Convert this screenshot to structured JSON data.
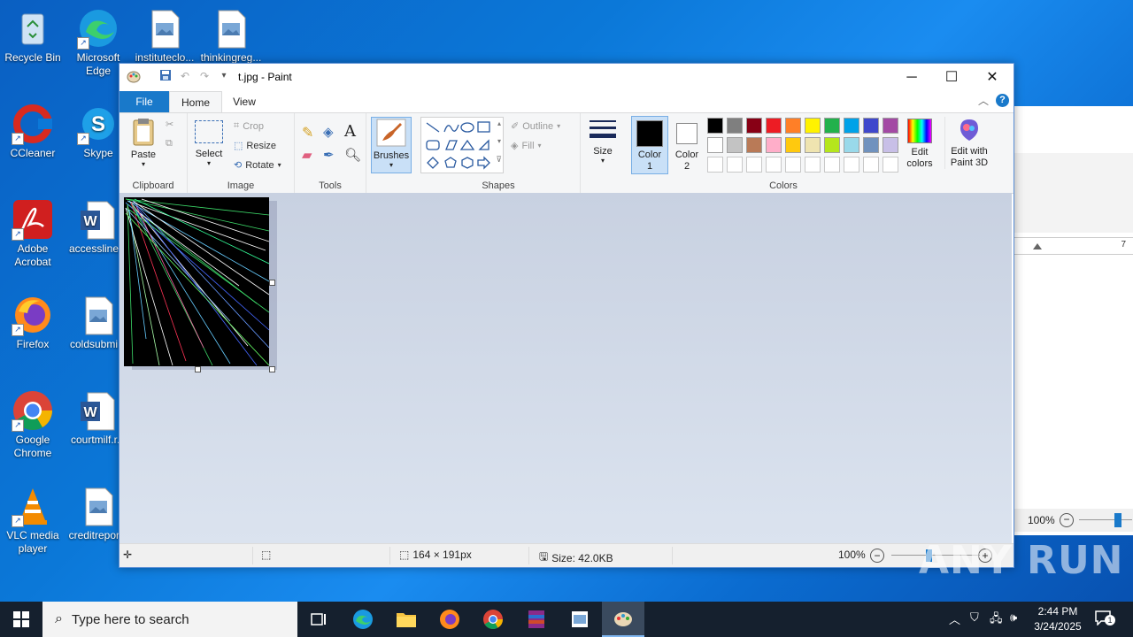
{
  "desktop": {
    "icons": [
      {
        "label": "Recycle Bin",
        "icon": "recycle-bin-icon"
      },
      {
        "label": "Microsoft Edge",
        "icon": "edge-icon"
      },
      {
        "label": "instituteclo...",
        "icon": "image-file-icon"
      },
      {
        "label": "thinkingreg...",
        "icon": "image-file-icon"
      },
      {
        "label": "CCleaner",
        "icon": "ccleaner-icon"
      },
      {
        "label": "Skype",
        "icon": "skype-icon"
      },
      {
        "label": "Adobe Acrobat",
        "icon": "acrobat-icon"
      },
      {
        "label": "accessline...",
        "icon": "word-doc-icon"
      },
      {
        "label": "Firefox",
        "icon": "firefox-icon"
      },
      {
        "label": "coldsubmi...",
        "icon": "image-file-icon"
      },
      {
        "label": "Google Chrome",
        "icon": "chrome-icon"
      },
      {
        "label": "courtmilf.r...",
        "icon": "word-doc-icon"
      },
      {
        "label": "VLC media player",
        "icon": "vlc-icon"
      },
      {
        "label": "creditrepor...",
        "icon": "image-file-icon"
      }
    ]
  },
  "paint": {
    "title": "t.jpg - Paint",
    "tabs": {
      "file": "File",
      "home": "Home",
      "view": "View"
    },
    "clipboard": {
      "paste": "Paste",
      "group": "Clipboard"
    },
    "image": {
      "select": "Select",
      "crop": "Crop",
      "resize": "Resize",
      "rotate": "Rotate",
      "group": "Image"
    },
    "tools": {
      "group": "Tools"
    },
    "brushes": "Brushes",
    "shapes": {
      "outline": "Outline",
      "fill": "Fill",
      "group": "Shapes"
    },
    "size": "Size",
    "color1": "Color 1",
    "color2": "Color 2",
    "colors_group": "Colors",
    "edit_colors": "Edit colors",
    "edit_3d": "Edit with Paint 3D",
    "palette_row1": [
      "#000000",
      "#7f7f7f",
      "#880015",
      "#ed1c24",
      "#ff7f27",
      "#fff200",
      "#22b14c",
      "#00a2e8",
      "#3f48cc",
      "#a349a4"
    ],
    "palette_row2": [
      "#ffffff",
      "#c3c3c3",
      "#b97a57",
      "#ffaec9",
      "#ffc90e",
      "#efe4b0",
      "#b5e61d",
      "#99d9ea",
      "#7092be",
      "#c8bfe7"
    ],
    "status": {
      "dimensions": "164 × 191px",
      "size": "Size: 42.0KB",
      "zoom": "100%"
    }
  },
  "word_bg": {
    "ruler_mark": "7",
    "zoom": "100%"
  },
  "taskbar": {
    "search_placeholder": "Type here to search",
    "time": "2:44 PM",
    "date": "3/24/2025",
    "notifications": "1"
  },
  "watermark": "ANY RUN"
}
